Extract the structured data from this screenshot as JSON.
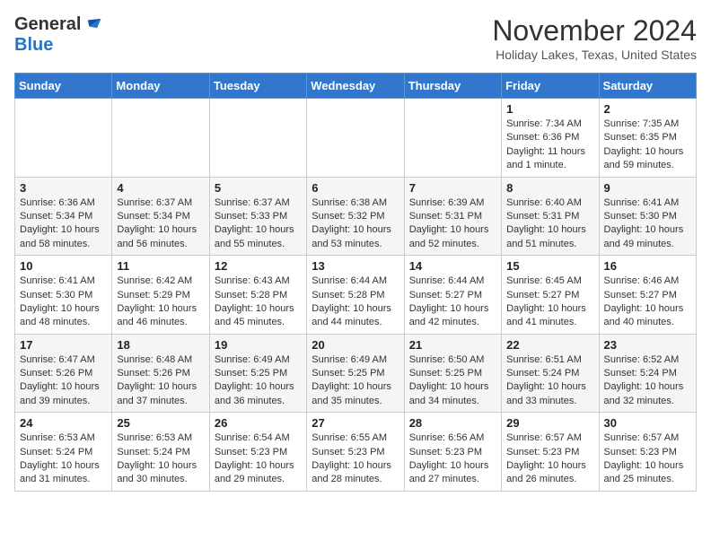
{
  "header": {
    "logo_general": "General",
    "logo_blue": "Blue",
    "month": "November 2024",
    "location": "Holiday Lakes, Texas, United States"
  },
  "days_of_week": [
    "Sunday",
    "Monday",
    "Tuesday",
    "Wednesday",
    "Thursday",
    "Friday",
    "Saturday"
  ],
  "weeks": [
    [
      {
        "day": "",
        "info": ""
      },
      {
        "day": "",
        "info": ""
      },
      {
        "day": "",
        "info": ""
      },
      {
        "day": "",
        "info": ""
      },
      {
        "day": "",
        "info": ""
      },
      {
        "day": "1",
        "info": "Sunrise: 7:34 AM\nSunset: 6:36 PM\nDaylight: 11 hours and 1 minute."
      },
      {
        "day": "2",
        "info": "Sunrise: 7:35 AM\nSunset: 6:35 PM\nDaylight: 10 hours and 59 minutes."
      }
    ],
    [
      {
        "day": "3",
        "info": "Sunrise: 6:36 AM\nSunset: 5:34 PM\nDaylight: 10 hours and 58 minutes."
      },
      {
        "day": "4",
        "info": "Sunrise: 6:37 AM\nSunset: 5:34 PM\nDaylight: 10 hours and 56 minutes."
      },
      {
        "day": "5",
        "info": "Sunrise: 6:37 AM\nSunset: 5:33 PM\nDaylight: 10 hours and 55 minutes."
      },
      {
        "day": "6",
        "info": "Sunrise: 6:38 AM\nSunset: 5:32 PM\nDaylight: 10 hours and 53 minutes."
      },
      {
        "day": "7",
        "info": "Sunrise: 6:39 AM\nSunset: 5:31 PM\nDaylight: 10 hours and 52 minutes."
      },
      {
        "day": "8",
        "info": "Sunrise: 6:40 AM\nSunset: 5:31 PM\nDaylight: 10 hours and 51 minutes."
      },
      {
        "day": "9",
        "info": "Sunrise: 6:41 AM\nSunset: 5:30 PM\nDaylight: 10 hours and 49 minutes."
      }
    ],
    [
      {
        "day": "10",
        "info": "Sunrise: 6:41 AM\nSunset: 5:30 PM\nDaylight: 10 hours and 48 minutes."
      },
      {
        "day": "11",
        "info": "Sunrise: 6:42 AM\nSunset: 5:29 PM\nDaylight: 10 hours and 46 minutes."
      },
      {
        "day": "12",
        "info": "Sunrise: 6:43 AM\nSunset: 5:28 PM\nDaylight: 10 hours and 45 minutes."
      },
      {
        "day": "13",
        "info": "Sunrise: 6:44 AM\nSunset: 5:28 PM\nDaylight: 10 hours and 44 minutes."
      },
      {
        "day": "14",
        "info": "Sunrise: 6:44 AM\nSunset: 5:27 PM\nDaylight: 10 hours and 42 minutes."
      },
      {
        "day": "15",
        "info": "Sunrise: 6:45 AM\nSunset: 5:27 PM\nDaylight: 10 hours and 41 minutes."
      },
      {
        "day": "16",
        "info": "Sunrise: 6:46 AM\nSunset: 5:27 PM\nDaylight: 10 hours and 40 minutes."
      }
    ],
    [
      {
        "day": "17",
        "info": "Sunrise: 6:47 AM\nSunset: 5:26 PM\nDaylight: 10 hours and 39 minutes."
      },
      {
        "day": "18",
        "info": "Sunrise: 6:48 AM\nSunset: 5:26 PM\nDaylight: 10 hours and 37 minutes."
      },
      {
        "day": "19",
        "info": "Sunrise: 6:49 AM\nSunset: 5:25 PM\nDaylight: 10 hours and 36 minutes."
      },
      {
        "day": "20",
        "info": "Sunrise: 6:49 AM\nSunset: 5:25 PM\nDaylight: 10 hours and 35 minutes."
      },
      {
        "day": "21",
        "info": "Sunrise: 6:50 AM\nSunset: 5:25 PM\nDaylight: 10 hours and 34 minutes."
      },
      {
        "day": "22",
        "info": "Sunrise: 6:51 AM\nSunset: 5:24 PM\nDaylight: 10 hours and 33 minutes."
      },
      {
        "day": "23",
        "info": "Sunrise: 6:52 AM\nSunset: 5:24 PM\nDaylight: 10 hours and 32 minutes."
      }
    ],
    [
      {
        "day": "24",
        "info": "Sunrise: 6:53 AM\nSunset: 5:24 PM\nDaylight: 10 hours and 31 minutes."
      },
      {
        "day": "25",
        "info": "Sunrise: 6:53 AM\nSunset: 5:24 PM\nDaylight: 10 hours and 30 minutes."
      },
      {
        "day": "26",
        "info": "Sunrise: 6:54 AM\nSunset: 5:23 PM\nDaylight: 10 hours and 29 minutes."
      },
      {
        "day": "27",
        "info": "Sunrise: 6:55 AM\nSunset: 5:23 PM\nDaylight: 10 hours and 28 minutes."
      },
      {
        "day": "28",
        "info": "Sunrise: 6:56 AM\nSunset: 5:23 PM\nDaylight: 10 hours and 27 minutes."
      },
      {
        "day": "29",
        "info": "Sunrise: 6:57 AM\nSunset: 5:23 PM\nDaylight: 10 hours and 26 minutes."
      },
      {
        "day": "30",
        "info": "Sunrise: 6:57 AM\nSunset: 5:23 PM\nDaylight: 10 hours and 25 minutes."
      }
    ]
  ]
}
